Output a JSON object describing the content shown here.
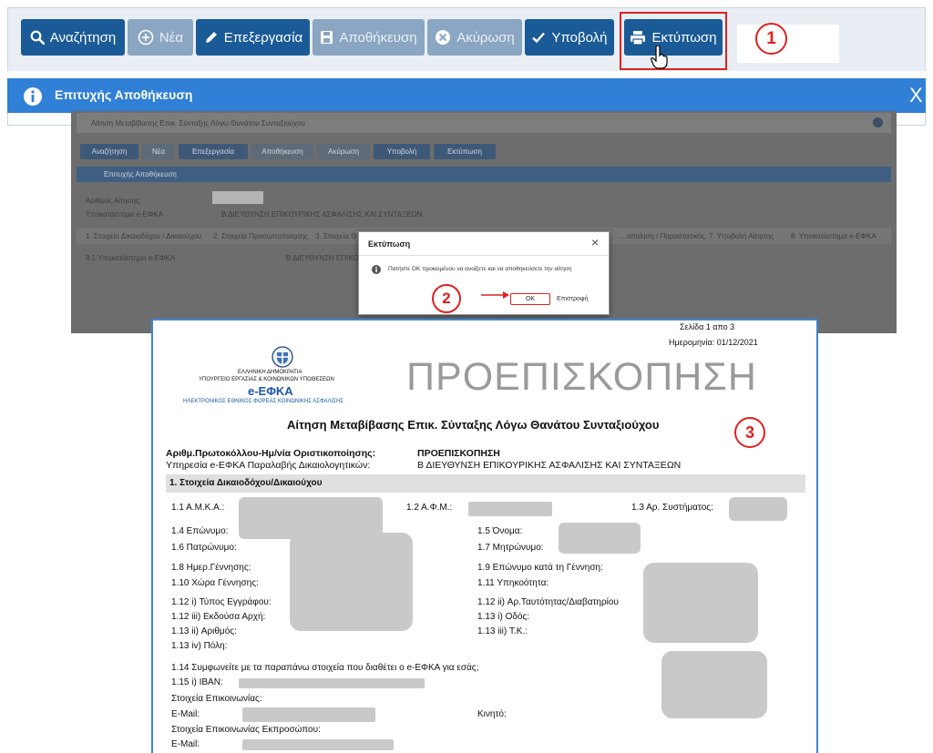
{
  "toolbar": {
    "buttons": [
      {
        "label": "Αναζήτηση",
        "icon": "search-icon",
        "enabled": true
      },
      {
        "label": "Νέα",
        "icon": "plus-circle-icon",
        "enabled": false
      },
      {
        "label": "Επεξεργασία",
        "icon": "pencil-icon",
        "enabled": true
      },
      {
        "label": "Αποθήκευση",
        "icon": "save-icon",
        "enabled": false
      },
      {
        "label": "Ακύρωση",
        "icon": "cancel-icon",
        "enabled": false
      },
      {
        "label": "Υποβολή",
        "icon": "check-icon",
        "enabled": true
      },
      {
        "label": "Εκτύπωση",
        "icon": "printer-icon",
        "enabled": true
      }
    ]
  },
  "message_bar": {
    "text": "Επιτυχής Αποθήκευση",
    "icon": "info-icon",
    "close": "X"
  },
  "steps": [
    "1",
    "2",
    "3"
  ],
  "background_screen": {
    "title": "Αίτηση Μεταβίβασης Επικ. Σύνταξης Λόγω Θανάτου Συνταξιούχου",
    "buttons": [
      "Αναζήτηση",
      "Νέα",
      "Επεξεργασία",
      "Αποθήκευση",
      "Ακύρωση",
      "Υποβολή",
      "Εκτύπωση"
    ],
    "message": "Επιτυχής Αποθήκευση",
    "fields": [
      {
        "label": "Αριθμός Αίτησης:",
        "value": ""
      },
      {
        "label": "Υποκατάστημα e-ΕΦΚΑ",
        "value": "Β ΔΙΕΥΘΥΝΣΗ ΕΠΙΚΟΥΡΙΚΗΣ ΑΣΦΑΛΙΣΗΣ ΚΑΙ ΣΥΝΤΑΞΕΩΝ"
      }
    ],
    "tabs": [
      "1. Στοιχεία Δικαιοδόχου / Δικαιούχου",
      "2. Στοιχεία Προσωποποίησης",
      "3. Στοιχεία Θ",
      "…οποίηση / Παραστατικός",
      "7. Υποβολή Αίτησης",
      "8. Υποκατάστημα e-ΕΦΚΑ"
    ],
    "tab_row": {
      "label": "8.1 Υποκατάστημα e-ΕΦΚΑ",
      "value": "Β ΔΙΕΥΘΥΝΣΗ ΕΠΙΚΟΥ"
    }
  },
  "dialog": {
    "title": "Εκτύπωση",
    "message": "Πατήστε ΟΚ προκειμένου να ανοίξετε και να αποθηκεύσετε την αίτηση",
    "ok": "ΟΚ",
    "back": "Επιστροφή",
    "close": "×"
  },
  "document": {
    "page": "Σελίδα 1 απο 3",
    "date": "Ημερομηνία: 01/12/2021",
    "org_lines": [
      "ΕΛΛΗΝΙΚΗ ΔΗΜΟΚΡΑΤΙΑ",
      "ΥΠΟΥΡΓΕΙΟ ΕΡΓΑΣΙΑΣ & ΚΟΙΝΩΝΙΚΩΝ ΥΠΟΘΕΣΕΩΝ"
    ],
    "logo_text": "e-ΕΦΚΑ",
    "org_full": "ΗΛΕΚΤΡΟΝΙΚΟΣ ΕΘΝΙΚΟΣ ΦΟΡΕΑΣ ΚΟΙΝΩΝΙΚΗΣ ΑΣΦΑΛΙΣΗΣ",
    "watermark": "ΠΡΟΕΠΙΣΚΟΠΗΣΗ",
    "title": "Αίτηση Μεταβίβασης Επικ. Σύνταξης Λόγω Θανάτου Συνταξιούχου",
    "protocol_label": "Αριθμ.Πρωτοκόλλου-Ημ/νία Οριστικοποίησης:",
    "protocol_value": "ΠΡΟΕΠΙΣΚΟΠΗΣΗ",
    "service_label": "Υπηρεσία e-ΕΦΚΑ Παραλαβής Δικαιολογητικών:",
    "service_value": "Β ΔΙΕΥΘΥΝΣΗ ΕΠΙΚΟΥΡΙΚΗΣ ΑΣΦΑΛΙΣΗΣ ΚΑΙ ΣΥΝΤΑΞΕΩΝ",
    "section": "1. Στοιχεία Δικαιοδόχου/Δικαιούχου",
    "labels": {
      "amka": "1.1 Α.Μ.Κ.Α.:",
      "afm": "1.2 Α.Φ.Μ.:",
      "system": "1.3 Αρ. Συστήματος:",
      "surname": "1.4 Επώνυμο:",
      "name": "1.5 Όνομα:",
      "father": "1.6 Πατρώνυμο:",
      "mother": "1.7 Μητρώνυμο:",
      "birthdate": "1.8 Ημερ.Γέννησης:",
      "birth_surname": "1.9 Επώνυμο κατά τη Γέννηση:",
      "birth_country": "1.10 Χώρα Γέννησης:",
      "citizenship": "1.11 Υπηκοότητα:",
      "doc_type": "1.12 i) Τύπος Εγγράφου:",
      "doc_number": "1.12 ii) Αρ.Ταυτότητας/Διαβατηρίου",
      "issuer": "1.12 iii) Εκδούσα Αρχή:",
      "street": "1.13 i) Οδός:",
      "street_no": "1.13 ii) Αριθμός:",
      "postal": "1.13 iii) Τ.Κ.:",
      "city": "1.13 iv) Πόλη:",
      "agree": "1.14 Συμφωνείτε με τα παραπάνω στοιχεία που διαθέτει ο e-ΕΦΚΑ για εσάς;",
      "iban": "1.15 i) IBAN:",
      "contact": "Στοιχεία Επικοινωνίας:",
      "email": "E-Mail:",
      "mobile": "Κινητό:",
      "rep_contact": "Στοιχεία Επικοινωνίας Εκπροσώπου:",
      "rep_email": "E-Mail:"
    }
  },
  "colors": {
    "primary": "#1a5a97",
    "disabled": "#8aa6c2",
    "message": "#2f80d6",
    "highlight": "#e02020",
    "doc_border": "#3d86d4"
  }
}
